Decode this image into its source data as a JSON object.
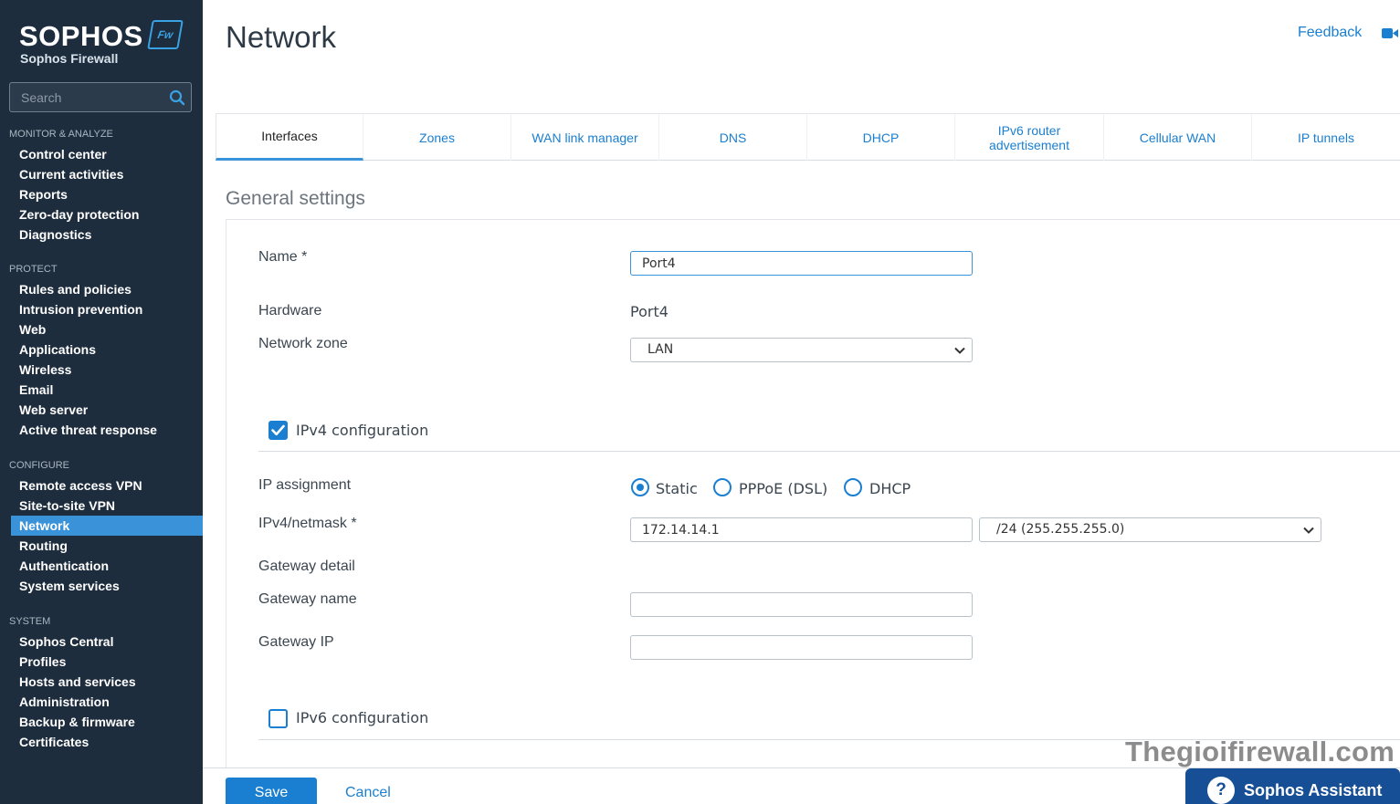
{
  "brand": {
    "logo": "SOPHOS",
    "badge": "Fw",
    "subtitle": "Sophos Firewall"
  },
  "search": {
    "placeholder": "Search"
  },
  "sidebar": {
    "monitor": {
      "heading": "MONITOR & ANALYZE",
      "items": [
        "Control center",
        "Current activities",
        "Reports",
        "Zero-day protection",
        "Diagnostics"
      ]
    },
    "protect": {
      "heading": "PROTECT",
      "items": [
        "Rules and policies",
        "Intrusion prevention",
        "Web",
        "Applications",
        "Wireless",
        "Email",
        "Web server",
        "Active threat response"
      ]
    },
    "configure": {
      "heading": "CONFIGURE",
      "items": [
        "Remote access VPN",
        "Site-to-site VPN",
        "Network",
        "Routing",
        "Authentication",
        "System services"
      ],
      "active": "Network"
    },
    "system": {
      "heading": "SYSTEM",
      "items": [
        "Sophos Central",
        "Profiles",
        "Hosts and services",
        "Administration",
        "Backup & firmware",
        "Certificates"
      ]
    }
  },
  "header": {
    "title": "Network",
    "feedback": "Feedback",
    "video_icon": "video-camera-icon"
  },
  "tabs": [
    {
      "label": "Interfaces",
      "active": true
    },
    {
      "label": "Zones",
      "active": false
    },
    {
      "label": "WAN link manager",
      "active": false
    },
    {
      "label": "DNS",
      "active": false
    },
    {
      "label": "DHCP",
      "active": false
    },
    {
      "label": "IPv6 router advertisement",
      "active": false
    },
    {
      "label": "Cellular WAN",
      "active": false
    },
    {
      "label": "IP tunnels",
      "active": false
    }
  ],
  "form": {
    "section_title": "General settings",
    "name": {
      "label": "Name *",
      "value": "Port4"
    },
    "hardware": {
      "label": "Hardware",
      "value": "Port4"
    },
    "network_zone": {
      "label": "Network zone",
      "value": "LAN"
    },
    "ipv4_config": {
      "label": "IPv4 configuration",
      "checked": true
    },
    "ip_assignment": {
      "label": "IP assignment",
      "options": [
        "Static",
        "PPPoE (DSL)",
        "DHCP"
      ],
      "selected": "Static"
    },
    "ipv4_netmask": {
      "label": "IPv4/netmask *",
      "ip": "172.14.14.1",
      "netmask": "/24 (255.255.255.0)"
    },
    "gateway_detail": {
      "label": "Gateway detail"
    },
    "gateway_name": {
      "label": "Gateway name",
      "value": ""
    },
    "gateway_ip": {
      "label": "Gateway IP",
      "value": ""
    },
    "ipv6_config": {
      "label": "IPv6 configuration",
      "checked": false
    }
  },
  "footer": {
    "save": "Save",
    "cancel": "Cancel"
  },
  "watermark": "Thegioifirewall.com",
  "assistant": {
    "icon": "?",
    "label": "Sophos Assistant"
  },
  "colors": {
    "sidebar_bg": "#1e2d3d",
    "accent": "#1a7fd0",
    "active_nav": "#3a93d8",
    "assistant_bg": "#174f96"
  }
}
